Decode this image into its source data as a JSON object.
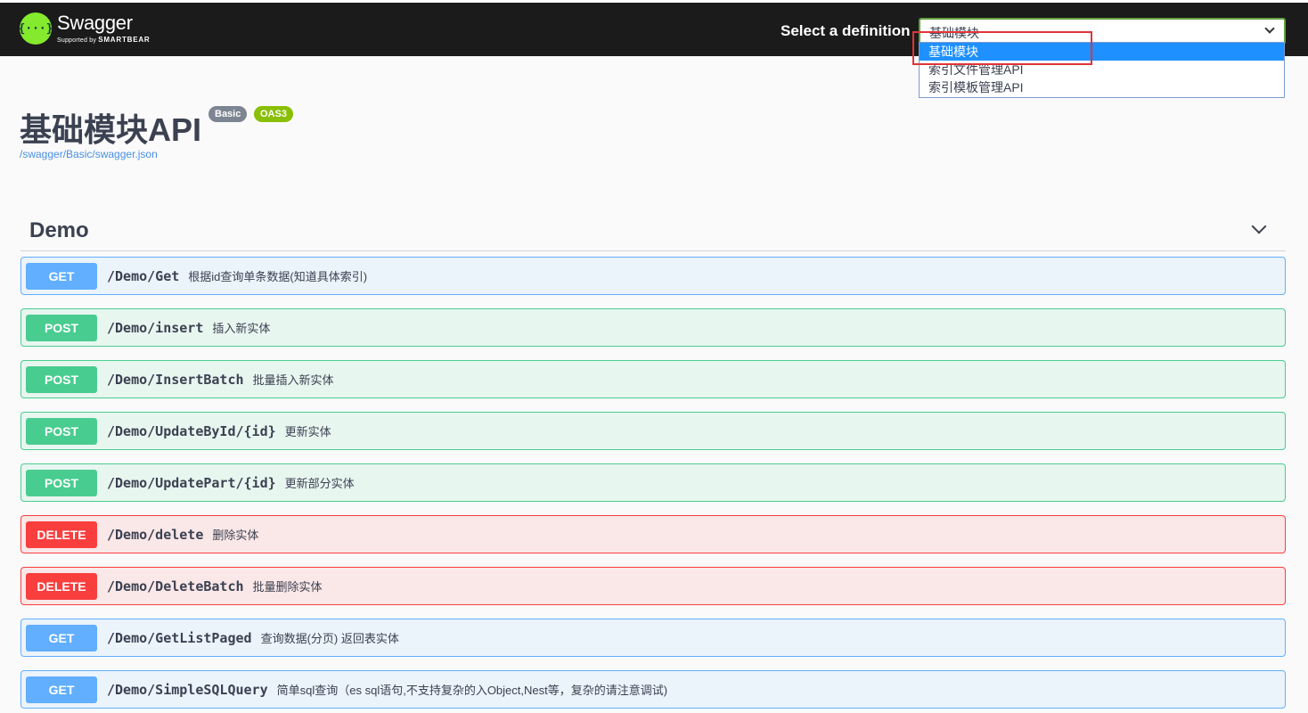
{
  "topbar": {
    "logo_glyph": "{···}",
    "logo_name": "Swagger",
    "logo_sub_prefix": "Supported by",
    "logo_sub_brand": "SMARTBEAR",
    "select_label": "Select a definition",
    "selected_definition": "基础模块",
    "definitions": [
      "基础模块",
      "索引文件管理API",
      "索引模板管理API"
    ]
  },
  "info": {
    "title": "基础模块API",
    "version_badge": "Basic",
    "spec_badge": "OAS3",
    "spec_url": "/swagger/Basic/swagger.json"
  },
  "tag": {
    "name": "Demo"
  },
  "operations": [
    {
      "method": "GET",
      "path": "/Demo/Get",
      "summary": "根据id查询单条数据(知道具体索引)"
    },
    {
      "method": "POST",
      "path": "/Demo/insert",
      "summary": "插入新实体"
    },
    {
      "method": "POST",
      "path": "/Demo/InsertBatch",
      "summary": "批量插入新实体"
    },
    {
      "method": "POST",
      "path": "/Demo/UpdateById/{id}",
      "summary": "更新实体"
    },
    {
      "method": "POST",
      "path": "/Demo/UpdatePart/{id}",
      "summary": "更新部分实体"
    },
    {
      "method": "DELETE",
      "path": "/Demo/delete",
      "summary": "删除实体"
    },
    {
      "method": "DELETE",
      "path": "/Demo/DeleteBatch",
      "summary": "批量删除实体"
    },
    {
      "method": "GET",
      "path": "/Demo/GetListPaged",
      "summary": "查询数据(分页) 返回表实体"
    },
    {
      "method": "GET",
      "path": "/Demo/SimpleSQLQuery",
      "summary": "简单sql查询（es sql语句,不支持复杂的入Object,Nest等，复杂的请注意调试)"
    }
  ],
  "colors": {
    "get": "#61affe",
    "post": "#49cc90",
    "delete": "#f93e3e",
    "brand": "#85ea2d",
    "highlight": "#e0343a"
  }
}
